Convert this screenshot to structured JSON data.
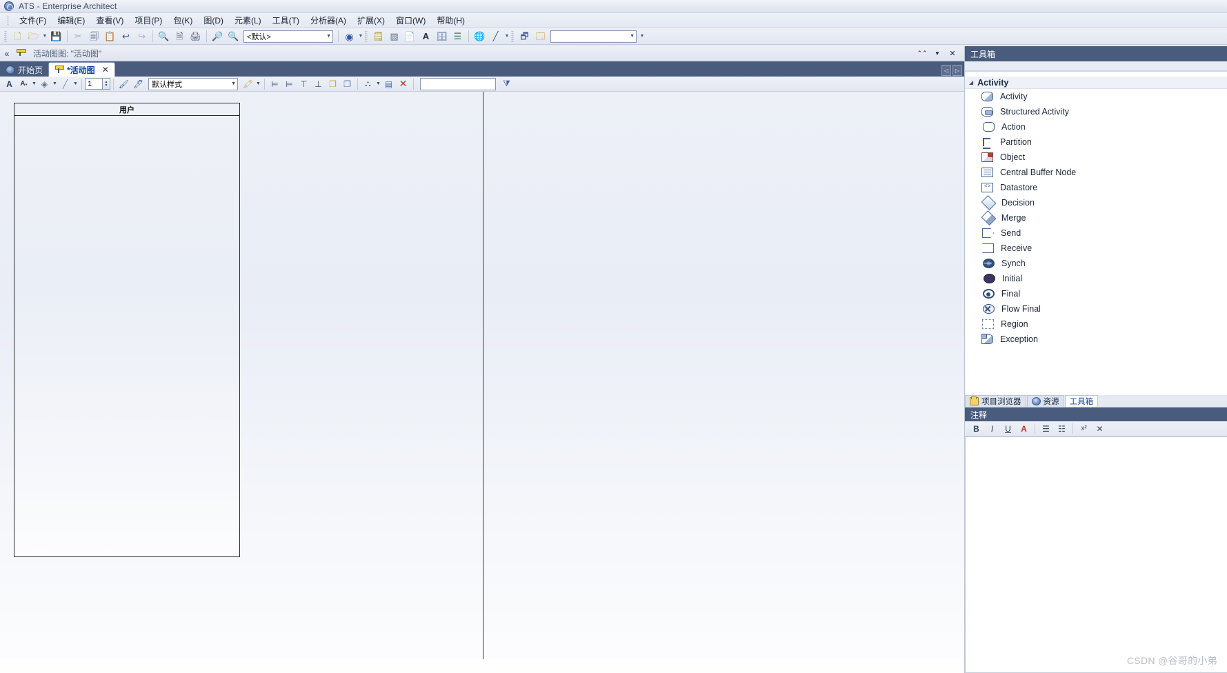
{
  "window": {
    "title": "ATS - Enterprise Architect",
    "app_icon": "enterprise-architect-icon"
  },
  "menubar": {
    "items": [
      {
        "label": "文件(F)"
      },
      {
        "label": "编辑(E)"
      },
      {
        "label": "查看(V)"
      },
      {
        "label": "项目(P)"
      },
      {
        "label": "包(K)"
      },
      {
        "label": "图(D)"
      },
      {
        "label": "元素(L)"
      },
      {
        "label": "工具(T)"
      },
      {
        "label": "分析器(A)"
      },
      {
        "label": "扩展(X)"
      },
      {
        "label": "窗口(W)"
      },
      {
        "label": "帮助(H)"
      }
    ]
  },
  "toolbar": {
    "buttons": [
      {
        "name": "new-file-icon",
        "glyph": "🗋"
      },
      {
        "name": "open-folder-icon",
        "glyph": "🗁"
      },
      {
        "name": "save-icon",
        "glyph": "💾"
      },
      {
        "name": "cut-icon",
        "glyph": "✂"
      },
      {
        "name": "copy-icon",
        "glyph": "🗐"
      },
      {
        "name": "paste-icon",
        "glyph": "📋"
      },
      {
        "name": "undo-icon",
        "glyph": "↩"
      },
      {
        "name": "redo-icon",
        "glyph": "↪"
      },
      {
        "name": "print-preview-icon",
        "glyph": "🔍"
      },
      {
        "name": "page-icon",
        "glyph": "🗎"
      },
      {
        "name": "print-icon",
        "glyph": "🖨"
      },
      {
        "name": "zoom-search-icon",
        "glyph": "🔎"
      },
      {
        "name": "find-in-project-icon",
        "glyph": "🔍"
      }
    ],
    "perspective_value": "<默认>",
    "help_icon": "help-icon",
    "right_buttons": [
      {
        "name": "new-element-icon",
        "glyph": "🗒"
      },
      {
        "name": "matrix-icon",
        "glyph": "▨"
      },
      {
        "name": "document-icon",
        "glyph": "📄"
      },
      {
        "name": "font-icon",
        "glyph": "A"
      },
      {
        "name": "rtf-report-icon",
        "glyph": "🗄"
      },
      {
        "name": "list-view-icon",
        "glyph": "☰"
      },
      {
        "name": "web-publish-icon",
        "glyph": "🌐"
      },
      {
        "name": "line-style-icon",
        "glyph": "╱"
      },
      {
        "name": "save-layout-icon",
        "glyph": "🗗"
      },
      {
        "name": "workspace-icon",
        "glyph": "🗔"
      }
    ],
    "search_value": ""
  },
  "breadcrumb": {
    "back_icon": "back-chevron-icon",
    "diagram_icon": "activity-diagram-icon",
    "text": "活动图图: \"活动图\"",
    "controls": [
      {
        "name": "collapse-ribbon-icon",
        "glyph": "⌃⌃"
      },
      {
        "name": "dropdown-icon",
        "glyph": "▼"
      },
      {
        "name": "close-diagram-icon",
        "glyph": "✕"
      }
    ]
  },
  "tabs": {
    "items": [
      {
        "label": "开始页",
        "active": false,
        "closable": false
      },
      {
        "label": "*活动图",
        "active": true,
        "closable": true,
        "close_glyph": "✕"
      }
    ],
    "nav_prev": "◁",
    "nav_next": "▷"
  },
  "format_toolbar": {
    "font_color_icon": "font-color-icon",
    "font_style_icon": "font-style-icon",
    "fill_color_icon": "fill-color-icon",
    "line_color_icon": "line-color-icon",
    "line_width_value": "1",
    "brush_icon": "format-painter-icon",
    "eyedropper_icon": "eyedropper-icon",
    "style_value": "默认样式",
    "highlight_icon": "highlighter-icon",
    "align_icons": [
      {
        "name": "align-left-icon",
        "glyph": "⊨"
      },
      {
        "name": "align-right-icon",
        "glyph": "⊨"
      },
      {
        "name": "align-top-icon",
        "glyph": "⊤"
      },
      {
        "name": "align-bottom-icon",
        "glyph": "⊥"
      },
      {
        "name": "same-width-icon",
        "glyph": "❐"
      },
      {
        "name": "same-height-icon",
        "glyph": "❐"
      }
    ],
    "layout-icon": "auto-layout-icon",
    "lock_icon": "lock-icon",
    "delete_icon": "delete-icon",
    "delete_glyph": "✕",
    "search_value": "",
    "filter_icon": "filter-icon",
    "filter_glyph": "⧩"
  },
  "canvas": {
    "partition": {
      "name": "用户"
    },
    "scrollbar": {
      "up_glyph": "▲",
      "down_glyph": "▼"
    }
  },
  "toolbox": {
    "title": "工具箱",
    "group": {
      "label": "Activity",
      "expander_glyph": "◢"
    },
    "items": [
      {
        "label": "Activity",
        "icon": "activity-icon"
      },
      {
        "label": "Structured Activity",
        "icon": "structured-activity-icon"
      },
      {
        "label": "Action",
        "icon": "action-icon"
      },
      {
        "label": "Partition",
        "icon": "partition-icon"
      },
      {
        "label": "Object",
        "icon": "object-icon"
      },
      {
        "label": "Central Buffer Node",
        "icon": "central-buffer-node-icon"
      },
      {
        "label": "Datastore",
        "icon": "datastore-icon"
      },
      {
        "label": "Decision",
        "icon": "decision-icon"
      },
      {
        "label": "Merge",
        "icon": "merge-icon"
      },
      {
        "label": "Send",
        "icon": "send-icon"
      },
      {
        "label": "Receive",
        "icon": "receive-icon"
      },
      {
        "label": "Synch",
        "icon": "synch-icon"
      },
      {
        "label": "Initial",
        "icon": "initial-icon"
      },
      {
        "label": "Final",
        "icon": "final-icon"
      },
      {
        "label": "Flow Final",
        "icon": "flow-final-icon"
      },
      {
        "label": "Region",
        "icon": "region-icon"
      },
      {
        "label": "Exception",
        "icon": "exception-icon"
      }
    ]
  },
  "panel_tabs": {
    "items": [
      {
        "label": "项目浏览器",
        "icon": "project-browser-icon",
        "selected": false
      },
      {
        "label": "资源",
        "icon": "resources-icon",
        "selected": false
      },
      {
        "label": "工具箱",
        "icon": "toolbox-icon",
        "selected": true
      }
    ]
  },
  "notes": {
    "title": "注释",
    "toolbar": [
      {
        "name": "bold-button",
        "glyph": "B"
      },
      {
        "name": "italic-button",
        "glyph": "I"
      },
      {
        "name": "underline-button",
        "glyph": "U"
      },
      {
        "name": "text-color-button",
        "glyph": "A"
      },
      {
        "name": "bullet-list-button",
        "glyph": "☰"
      },
      {
        "name": "numbered-list-button",
        "glyph": "☷"
      },
      {
        "name": "superscript-button",
        "glyph": "x²"
      },
      {
        "name": "close-notes-button",
        "glyph": "✕"
      }
    ],
    "content": ""
  },
  "watermark": {
    "text": "CSDN @谷哥的小弟"
  }
}
